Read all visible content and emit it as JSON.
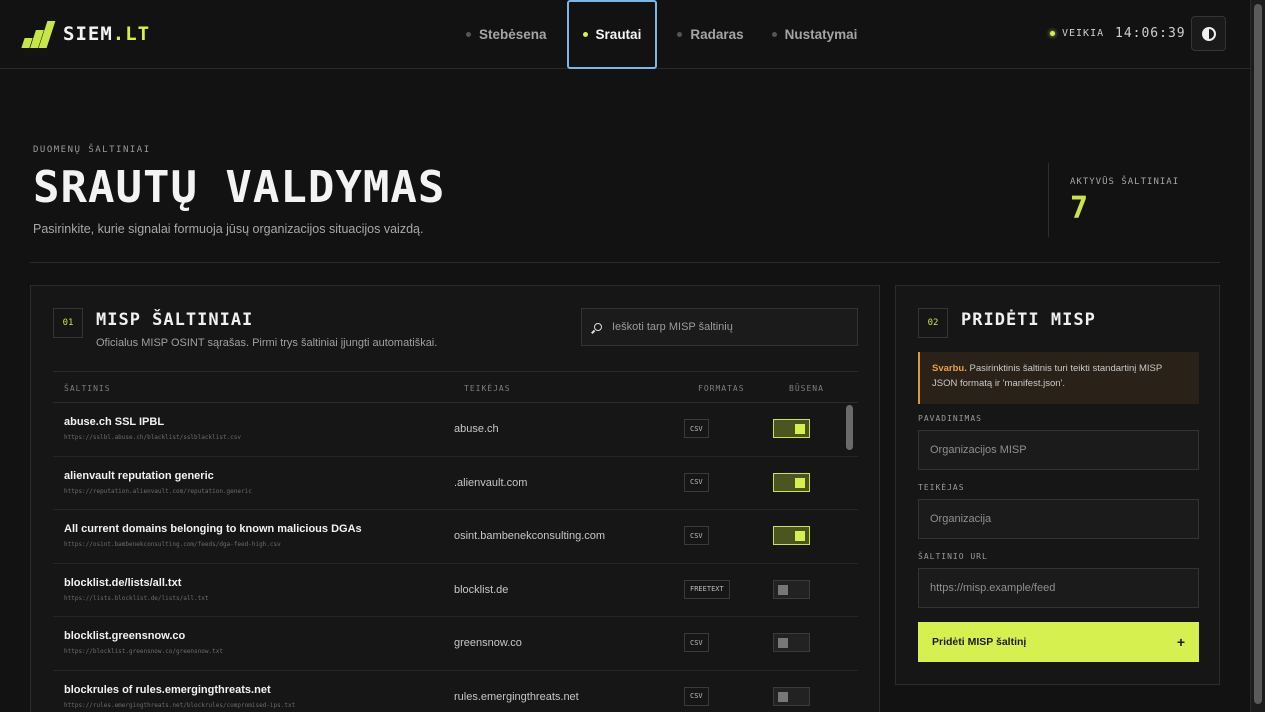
{
  "app": {
    "name_main": "SIEM",
    "name_accent": ".LT"
  },
  "nav": [
    {
      "label": "Stebėsena",
      "active": false
    },
    {
      "label": "Srautai",
      "active": true
    },
    {
      "label": "Radaras",
      "active": false
    },
    {
      "label": "Nustatymai",
      "active": false
    }
  ],
  "status": {
    "label": "VEIKIA",
    "time": "14:06:39"
  },
  "header": {
    "eyebrow": "DUOMENŲ ŠALTINIAI",
    "title": "SRAUTŲ VALDYMAS",
    "subtitle": "Pasirinkite, kurie signalai formuoja jūsų organizacijos situacijos vaizdą.",
    "stat_label": "AKTYVŪS ŠALTINIAI",
    "stat_value": "7"
  },
  "sources_panel": {
    "badge": "01",
    "title": "MISP ŠALTINIAI",
    "description": "Oficialus MISP OSINT sąrašas. Pirmi trys šaltiniai įjungti automatiškai.",
    "search_placeholder": "Ieškoti tarp MISP šaltinių",
    "columns": {
      "source": "ŠALTINIS",
      "provider": "TEIKĖJAS",
      "format": "FORMATAS",
      "status": "BŪSENA"
    },
    "rows": [
      {
        "name": "abuse.ch SSL IPBL",
        "url": "https://sslbl.abuse.ch/blacklist/sslblacklist.csv",
        "provider": "abuse.ch",
        "format": "CSV",
        "enabled": true
      },
      {
        "name": "alienvault reputation generic",
        "url": "https://reputation.alienvault.com/reputation.generic",
        "provider": ".alienvault.com",
        "format": "CSV",
        "enabled": true
      },
      {
        "name": "All current domains belonging to known malicious DGAs",
        "url": "https://osint.bambenekconsulting.com/feeds/dga-feed-high.csv",
        "provider": "osint.bambenekconsulting.com",
        "format": "CSV",
        "enabled": true
      },
      {
        "name": "blocklist.de/lists/all.txt",
        "url": "https://lists.blocklist.de/lists/all.txt",
        "provider": "blocklist.de",
        "format": "FREETEXT",
        "enabled": false
      },
      {
        "name": "blocklist.greensnow.co",
        "url": "https://blocklist.greensnow.co/greensnow.txt",
        "provider": "greensnow.co",
        "format": "CSV",
        "enabled": false
      },
      {
        "name": "blockrules of rules.emergingthreats.net",
        "url": "https://rules.emergingthreats.net/blockrules/compromised-ips.txt",
        "provider": "rules.emergingthreats.net",
        "format": "CSV",
        "enabled": false
      }
    ]
  },
  "add_panel": {
    "badge": "02",
    "title": "PRIDĖTI MISP",
    "notice_strong": "Svarbu.",
    "notice_text": " Pasirinktinis šaltinis turi teikti standartinį MISP JSON formatą ir 'manifest.json'.",
    "name_label": "PAVADINIMAS",
    "name_placeholder": "Organizacijos MISP",
    "provider_label": "TEIKĖJAS",
    "provider_placeholder": "Organizacija",
    "url_label": "ŠALTINIO URL",
    "url_placeholder": "https://misp.example/feed",
    "submit_label": "Pridėti MISP šaltinį",
    "submit_icon": "+"
  },
  "colors": {
    "accent": "#d6f04f",
    "warning": "#e0973a",
    "background": "#121212"
  }
}
